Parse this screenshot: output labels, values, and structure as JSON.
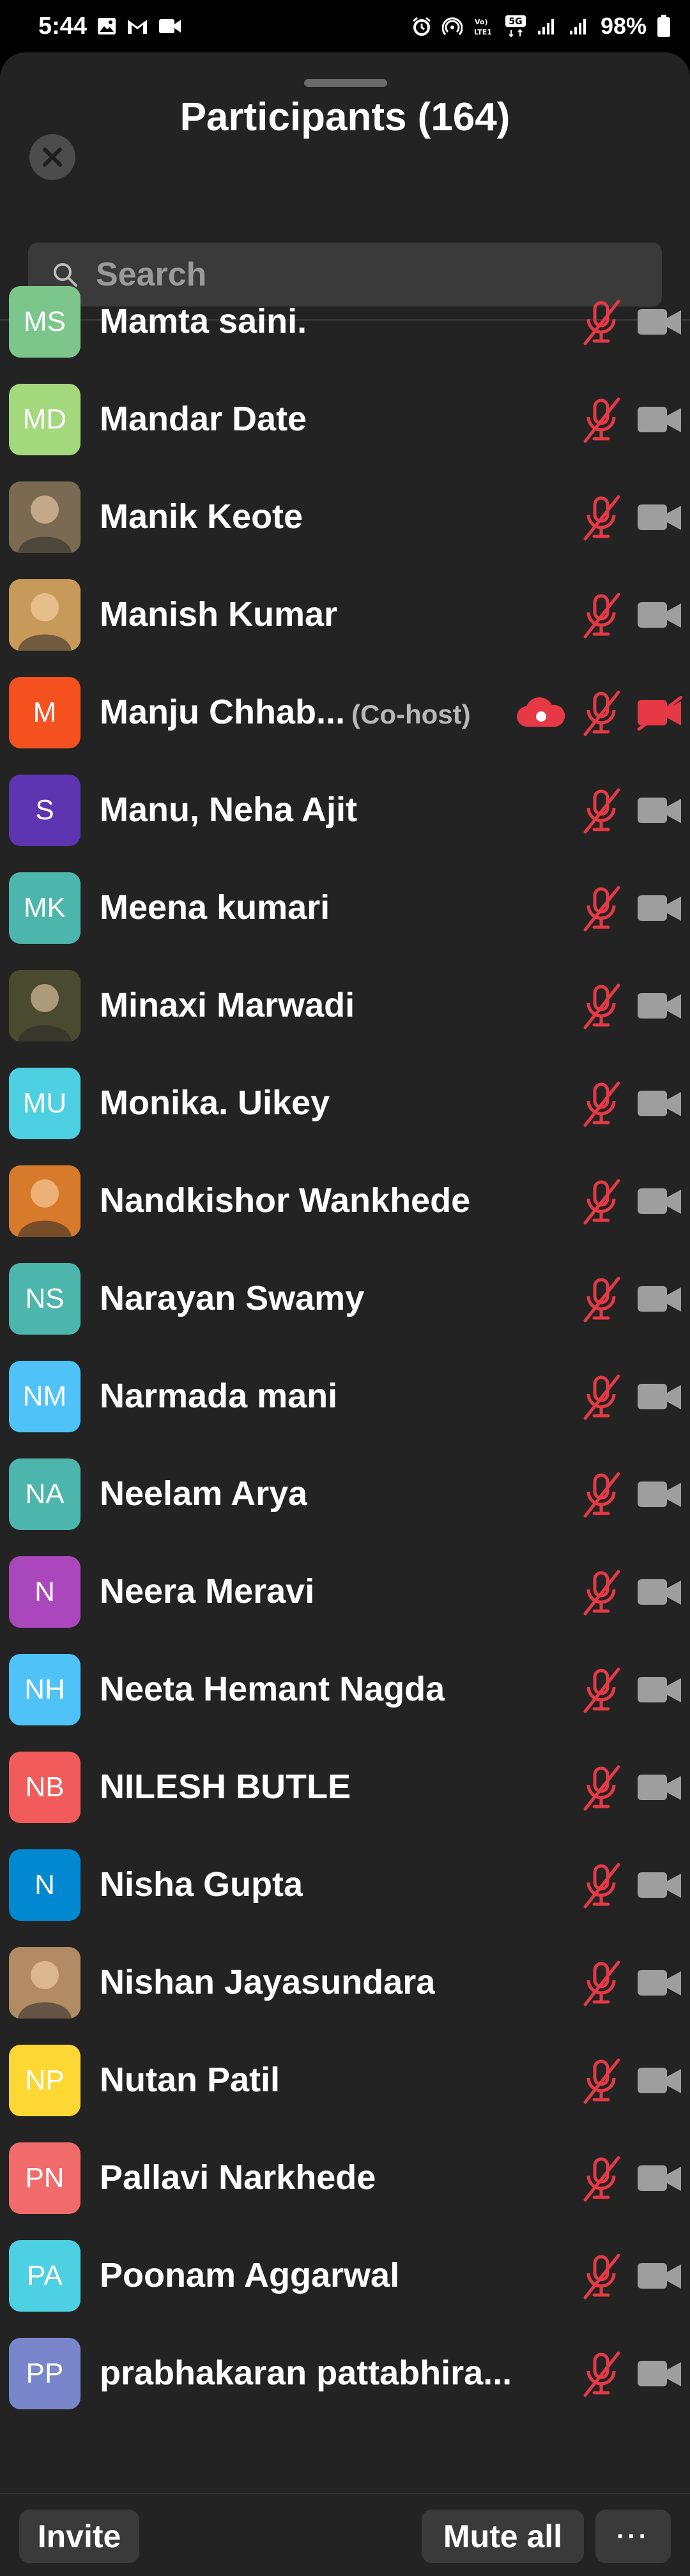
{
  "status_bar": {
    "time": "5:44",
    "battery": "98%",
    "network_label": "5G"
  },
  "header": {
    "title": "Participants (164)"
  },
  "search": {
    "placeholder": "Search"
  },
  "colors": {
    "sheet_bg": "#232323",
    "muted_red": "#e53946",
    "icon_grey": "#9e9e9e"
  },
  "participants": [
    {
      "name": "Mamta saini.",
      "initials": "MS",
      "avatar_color": "#7cc68c",
      "avatar_type": "initials"
    },
    {
      "name": "Mandar Date",
      "initials": "MD",
      "avatar_color": "#a3d87d",
      "avatar_type": "initials"
    },
    {
      "name": "Manik Keote",
      "initials": "",
      "avatar_color": "#7b6a52",
      "avatar_type": "photo"
    },
    {
      "name": "Manish Kumar",
      "initials": "",
      "avatar_color": "#c79a5a",
      "avatar_type": "photo"
    },
    {
      "name": "Manju Chhab...",
      "initials": "M",
      "avatar_color": "#f4511e",
      "avatar_type": "initials",
      "role": "(Co-host)",
      "recording": true,
      "video_off": true
    },
    {
      "name": "Manu, Neha Ajit",
      "initials": "S",
      "avatar_color": "#5e35b1",
      "avatar_type": "initials"
    },
    {
      "name": "Meena kumari",
      "initials": "MK",
      "avatar_color": "#4db6ac",
      "avatar_type": "initials"
    },
    {
      "name": "Minaxi Marwadi",
      "initials": "",
      "avatar_color": "#4a4a30",
      "avatar_type": "photo"
    },
    {
      "name": "Monika. Uikey",
      "initials": "MU",
      "avatar_color": "#4dd0e1",
      "avatar_type": "initials"
    },
    {
      "name": "Nandkishor Wankhede",
      "initials": "",
      "avatar_color": "#d87a2c",
      "avatar_type": "photo"
    },
    {
      "name": "Narayan Swamy",
      "initials": "NS",
      "avatar_color": "#4db6ac",
      "avatar_type": "initials"
    },
    {
      "name": "Narmada mani",
      "initials": "NM",
      "avatar_color": "#4fc3f7",
      "avatar_type": "initials"
    },
    {
      "name": "Neelam Arya",
      "initials": "NA",
      "avatar_color": "#4db6ac",
      "avatar_type": "initials"
    },
    {
      "name": "Neera Meravi",
      "initials": "N",
      "avatar_color": "#ab47bc",
      "avatar_type": "initials"
    },
    {
      "name": "Neeta Hemant Nagda",
      "initials": "NH",
      "avatar_color": "#4fc3f7",
      "avatar_type": "initials"
    },
    {
      "name": "NILESH BUTLE",
      "initials": "NB",
      "avatar_color": "#f25b5b",
      "avatar_type": "initials"
    },
    {
      "name": "Nisha Gupta",
      "initials": "N",
      "avatar_color": "#0288d1",
      "avatar_type": "initials"
    },
    {
      "name": "Nishan Jayasundara",
      "initials": "",
      "avatar_color": "#b08b64",
      "avatar_type": "photo"
    },
    {
      "name": "Nutan Patil",
      "initials": "NP",
      "avatar_color": "#fdd835",
      "avatar_type": "initials"
    },
    {
      "name": "Pallavi Narkhede",
      "initials": "PN",
      "avatar_color": "#f26b6b",
      "avatar_type": "initials"
    },
    {
      "name": "Poonam Aggarwal",
      "initials": "PA",
      "avatar_color": "#4dd0e1",
      "avatar_type": "initials"
    },
    {
      "name": "prabhakaran pattabhira...",
      "initials": "PP",
      "avatar_color": "#7986cb",
      "avatar_type": "initials"
    }
  ],
  "footer": {
    "invite_label": "Invite",
    "mute_all_label": "Mute all",
    "more_label": "···"
  }
}
